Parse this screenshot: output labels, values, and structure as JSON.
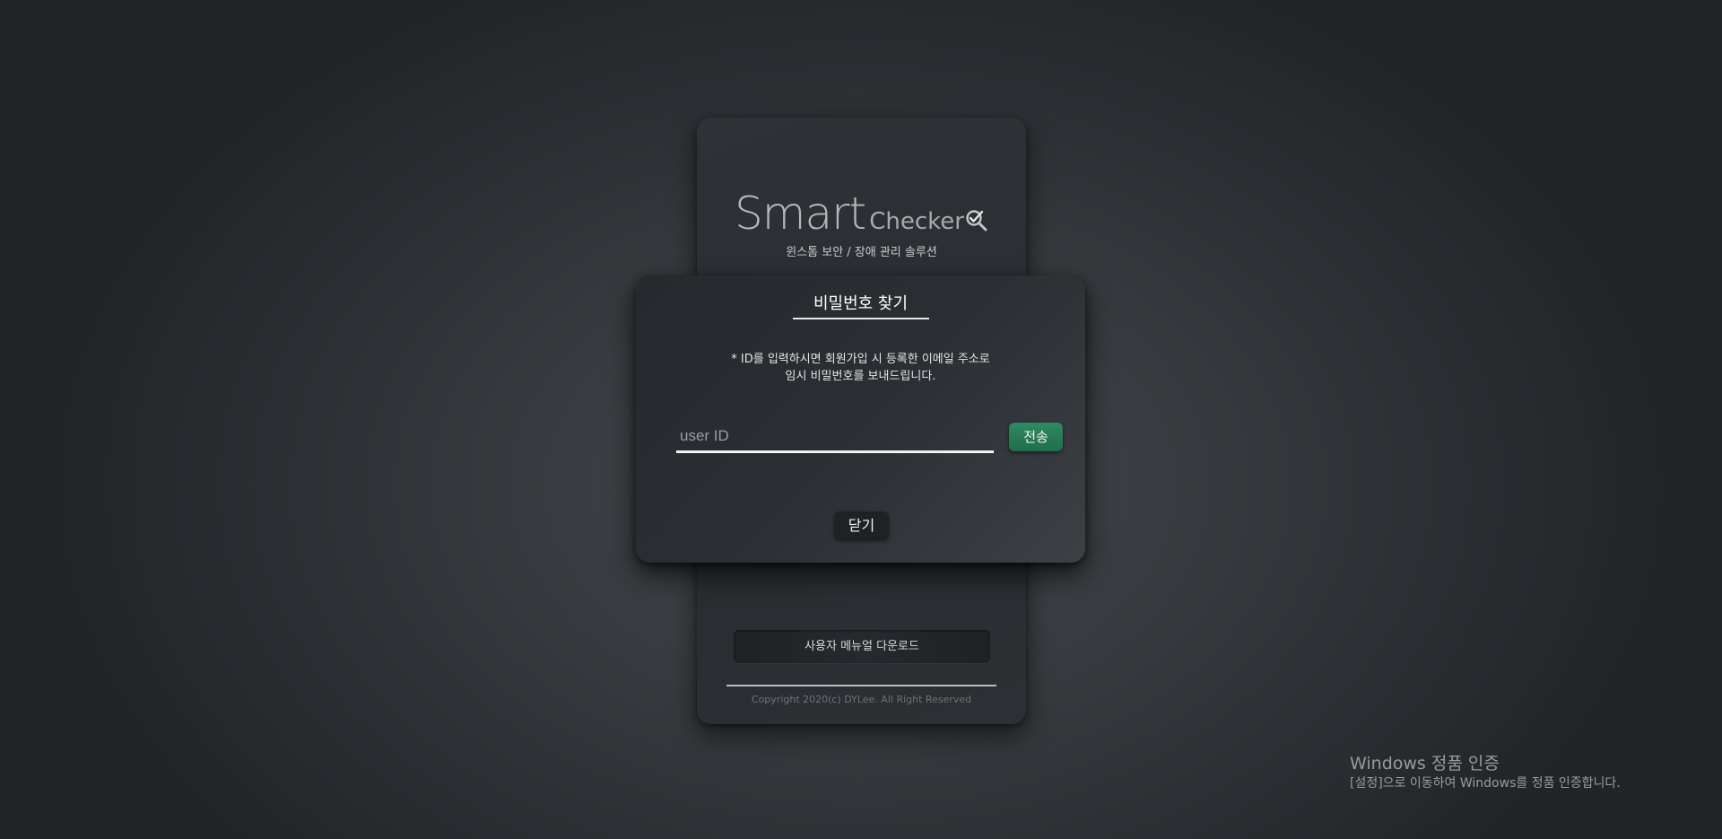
{
  "login_card": {
    "logo": {
      "smart": "Smart",
      "checker": "Checker",
      "icon": "magnifier-check-icon"
    },
    "subtitle": "윈스톰 보안 / 장애 관리 솔루션",
    "manual_button": "사용자 메뉴얼 다운로드",
    "copyright": "Copyright 2020(c) DYLee. All Right Reserved"
  },
  "modal": {
    "title": "비밀번호 찾기",
    "description_line1": "* ID를 입력하시면 회원가입 시 등록한 이메일 주소로",
    "description_line2": "임시 비밀번호를 보내드립니다.",
    "userid_input": {
      "placeholder": "user ID",
      "value": ""
    },
    "send_button": "전송",
    "close_button": "닫기"
  },
  "windows_watermark": {
    "title": "Windows 정품 인증",
    "subtitle": "[설정]으로 이동하여 Windows를 정품 인증합니다."
  },
  "colors": {
    "send_button": "#267a55",
    "modal_background": "#2b2e33",
    "page_background": "#36393d"
  }
}
